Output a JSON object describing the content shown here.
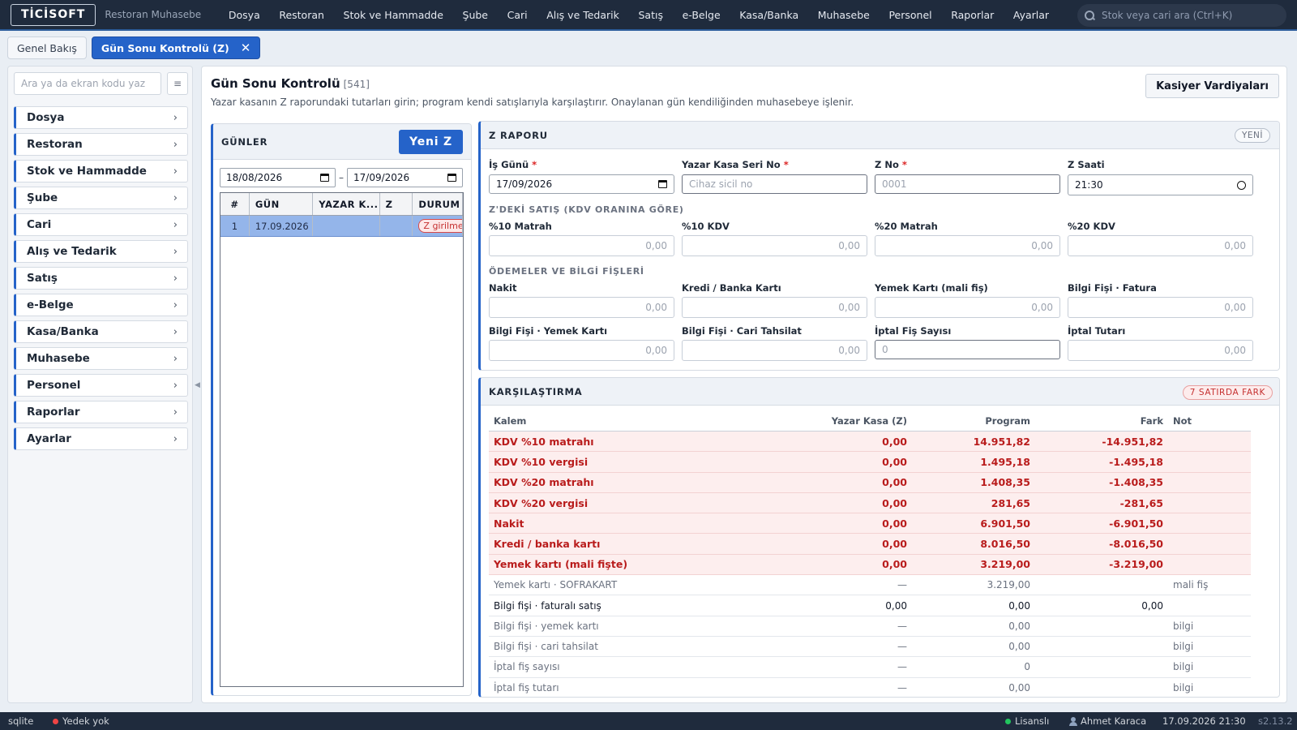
{
  "app": {
    "logo": "TİCİSOFT",
    "subtitle": "Restoran Muhasebe"
  },
  "menu": [
    "Dosya",
    "Restoran",
    "Stok ve Hammadde",
    "Şube",
    "Cari",
    "Alış ve Tedarik",
    "Satış",
    "e-Belge",
    "Kasa/Banka",
    "Muhasebe",
    "Personel",
    "Raporlar",
    "Ayarlar"
  ],
  "search": {
    "placeholder": "Stok veya cari ara (Ctrl+K)"
  },
  "tabs": [
    {
      "label": "Genel Bakış"
    },
    {
      "label": "Gün Sonu Kontrolü (Z)",
      "close": "✕"
    }
  ],
  "sidebar": {
    "search_placeholder": "Ara ya da ekran kodu yaz",
    "items": [
      "Dosya",
      "Restoran",
      "Stok ve Hammadde",
      "Şube",
      "Cari",
      "Alış ve Tedarik",
      "Satış",
      "e-Belge",
      "Kasa/Banka",
      "Muhasebe",
      "Personel",
      "Raporlar",
      "Ayarlar"
    ]
  },
  "page": {
    "title": "Gün Sonu Kontrolü",
    "code": "[541]",
    "subtitle": "Yazar kasanın Z raporundaki tutarları girin; program kendi satışlarıyla karşılaştırır. Onaylanan gün kendiliğinden muhasebeye işlenir.",
    "kasiyer_button": "Kasiyer Vardiyaları"
  },
  "days": {
    "header": "GÜNLER",
    "new_button": "Yeni Z",
    "date_from": "18/08/2026",
    "date_sep": "–",
    "date_to": "17/09/2026",
    "columns": [
      "#",
      "GÜN",
      "YAZAR K...",
      "Z",
      "DURUM"
    ],
    "rows": [
      {
        "no": "1",
        "day": "17.09.2026",
        "kasa": "",
        "z": "",
        "status": "Z girilmedi"
      }
    ]
  },
  "zreport": {
    "header": "Z RAPORU",
    "badge": "YENİ",
    "is_gunu_label": "İş Günü",
    "is_gunu_value": "17/09/2026",
    "seri_label": "Yazar Kasa Seri No",
    "seri_placeholder": "Cihaz sicil no",
    "zno_label": "Z No",
    "zno_placeholder": "0001",
    "zsaat_label": "Z Saati",
    "zsaat_value": "21:30",
    "req": "*",
    "sales_section": "Z'DEKİ SATIŞ (KDV ORANINA GÖRE)",
    "matrah10_label": "%10 Matrah",
    "matrah10_value": "0,00",
    "kdv10_label": "%10 KDV",
    "kdv10_value": "0,00",
    "matrah20_label": "%20 Matrah",
    "matrah20_value": "0,00",
    "kdv20_label": "%20 KDV",
    "kdv20_value": "0,00",
    "payments_section": "ÖDEMELER VE BİLGİ FİŞLERİ",
    "nakit_label": "Nakit",
    "nakit_value": "0,00",
    "kredi_label": "Kredi / Banka Kartı",
    "kredi_value": "0,00",
    "yemek_label": "Yemek Kartı (mali fiş)",
    "yemek_value": "0,00",
    "bf_fatura_label": "Bilgi Fişi · Fatura",
    "bf_fatura_value": "0,00",
    "bf_yemek_label": "Bilgi Fişi · Yemek Kartı",
    "bf_yemek_value": "0,00",
    "bf_cari_label": "Bilgi Fişi · Cari Tahsilat",
    "bf_cari_value": "0,00",
    "iptal_sayi_label": "İptal Fiş Sayısı",
    "iptal_sayi_value": "0",
    "iptal_tutar_label": "İptal Tutarı",
    "iptal_tutar_value": "0,00"
  },
  "compare": {
    "header": "KARŞILAŞTIRMA",
    "badge": "7 SATIRDA FARK",
    "columns": [
      "Kalem",
      "Yazar Kasa (Z)",
      "Program",
      "Fark",
      "Not"
    ],
    "rows": [
      {
        "kalem": "KDV %10 matrahı",
        "z": "0,00",
        "program": "14.951,82",
        "fark": "-14.951,82",
        "not": "",
        "style": "diff"
      },
      {
        "kalem": "KDV %10 vergisi",
        "z": "0,00",
        "program": "1.495,18",
        "fark": "-1.495,18",
        "not": "",
        "style": "diff"
      },
      {
        "kalem": "KDV %20 matrahı",
        "z": "0,00",
        "program": "1.408,35",
        "fark": "-1.408,35",
        "not": "",
        "style": "diff"
      },
      {
        "kalem": "KDV %20 vergisi",
        "z": "0,00",
        "program": "281,65",
        "fark": "-281,65",
        "not": "",
        "style": "diff"
      },
      {
        "kalem": "Nakit",
        "z": "0,00",
        "program": "6.901,50",
        "fark": "-6.901,50",
        "not": "",
        "style": "diff"
      },
      {
        "kalem": "Kredi / banka kartı",
        "z": "0,00",
        "program": "8.016,50",
        "fark": "-8.016,50",
        "not": "",
        "style": "diff"
      },
      {
        "kalem": "Yemek kartı (mali fişte)",
        "z": "0,00",
        "program": "3.219,00",
        "fark": "-3.219,00",
        "not": "",
        "style": "diff"
      },
      {
        "kalem": "Yemek kartı · SOFRAKART",
        "z": "—",
        "program": "3.219,00",
        "fark": "",
        "not": "mali fiş",
        "style": "muted"
      },
      {
        "kalem": "Bilgi fişi · faturalı satış",
        "z": "0,00",
        "program": "0,00",
        "fark": "0,00",
        "not": "",
        "style": "normal"
      },
      {
        "kalem": "Bilgi fişi · yemek kartı",
        "z": "—",
        "program": "0,00",
        "fark": "",
        "not": "bilgi",
        "style": "muted"
      },
      {
        "kalem": "Bilgi fişi · cari tahsilat",
        "z": "—",
        "program": "0,00",
        "fark": "",
        "not": "bilgi",
        "style": "muted"
      },
      {
        "kalem": "İptal fiş sayısı",
        "z": "—",
        "program": "0",
        "fark": "",
        "not": "bilgi",
        "style": "muted"
      },
      {
        "kalem": "İptal fiş tutarı",
        "z": "—",
        "program": "0,00",
        "fark": "",
        "not": "bilgi",
        "style": "muted"
      }
    ]
  },
  "status": {
    "db": "sqlite",
    "backup": "Yedek yok",
    "license": "Lisanslı",
    "user": "Ahmet Karaca",
    "datetime": "17.09.2026 21:30",
    "version": "s2.13.2"
  },
  "colors": {
    "accent": "#2563c9",
    "danger": "#c53030",
    "ok": "#22c55e",
    "topbar": "#1f2b3d"
  }
}
